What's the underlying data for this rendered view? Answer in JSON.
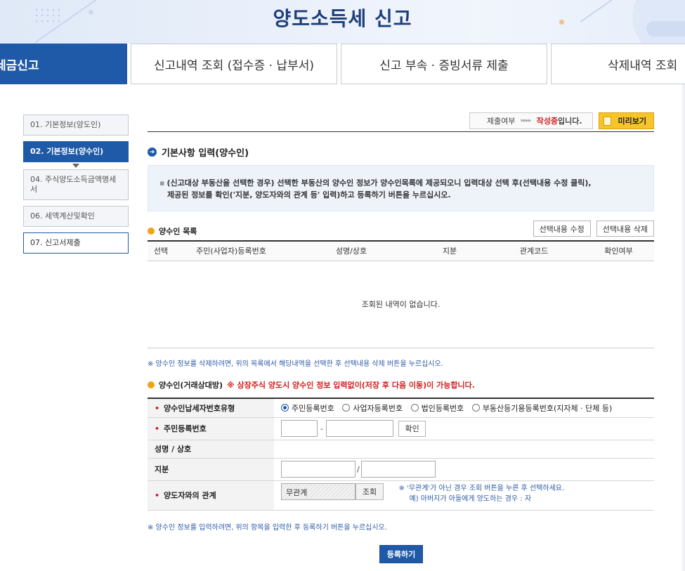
{
  "header": {
    "title": "양도소득세 신고"
  },
  "tabs": [
    {
      "label": "세금신고",
      "active": true
    },
    {
      "label": "신고내역 조회 (접수증 · 납부서)",
      "active": false
    },
    {
      "label": "신고 부속 · 증빙서류 제출",
      "active": false
    },
    {
      "label": "삭제내역 조회",
      "active": false
    }
  ],
  "sidebar": {
    "items": [
      {
        "label": "01. 기본정보(양도인)"
      },
      {
        "label": "02. 기본정보(양수인)"
      },
      {
        "label": "04. 주식양도소득금액명세서"
      },
      {
        "label": "06. 세액계산및확인"
      },
      {
        "label": "07. 신고서제출"
      }
    ]
  },
  "status": {
    "label": "제출여부",
    "arrows": "▸▸▸▸",
    "state": "작성중",
    "suffix": "입니다.",
    "preview_label": "미리보기"
  },
  "section": {
    "title": "기본사항 입력(양수인)",
    "notice_line1": "(신고대상 부동산을 선택한 경우) 선택한 부동산의 양수인 정보가 양수인목록에 제공되오니 입력대상 선택 후(선택내용 수정 클릭),",
    "notice_line2": "제공된 정보를 확인('지분, 양도자와의 관계 등' 입력)하고 등록하기 버튼을 누르십시오."
  },
  "list": {
    "title": "양수인 목록",
    "edit_label": "선택내용 수정",
    "delete_label": "선택내용 삭제",
    "columns": [
      "선택",
      "주민(사업자)등록번호",
      "성명/상호",
      "지분",
      "관계코드",
      "확인여부"
    ],
    "empty": "조회된 내역이 없습니다."
  },
  "note_delete": "※ 양수인 정보를 삭제하려면, 위의 목록에서 해당내역을 선택한 후 선택내용 삭제 버튼을 누르십시오.",
  "form": {
    "title": "양수인(거래상대방)",
    "warning": "※ 상장주식 양도시 양수인 정보 입력없이(저장 후 다음 이동)이 가능합니다.",
    "rows": {
      "id_type_label": "양수인납세자번호유형",
      "id_types": [
        "주민등록번호",
        "사업자등록번호",
        "법인등록번호",
        "부동산등기용등록번호(지자체 · 단체 등)"
      ],
      "rrn_label": "주민등록번호",
      "confirm_label": "확인",
      "name_label": "성명 / 상호",
      "share_label": "지분",
      "relation_label": "양도자와의 관계",
      "relation_value": "무관계",
      "lookup_label": "조회",
      "hint1": "※ '무관계'가 아닌 경우 조회 버튼을 누른 후 선택하세요.",
      "hint2": "예) 아버지가 아들에게 양도하는 경우 : 자"
    }
  },
  "note_register": "※ 양수인 정보를 입력하려면, 위의 항목을 입력한 후 등록하기 버튼을 누르십시오.",
  "register_label": "등록하기"
}
